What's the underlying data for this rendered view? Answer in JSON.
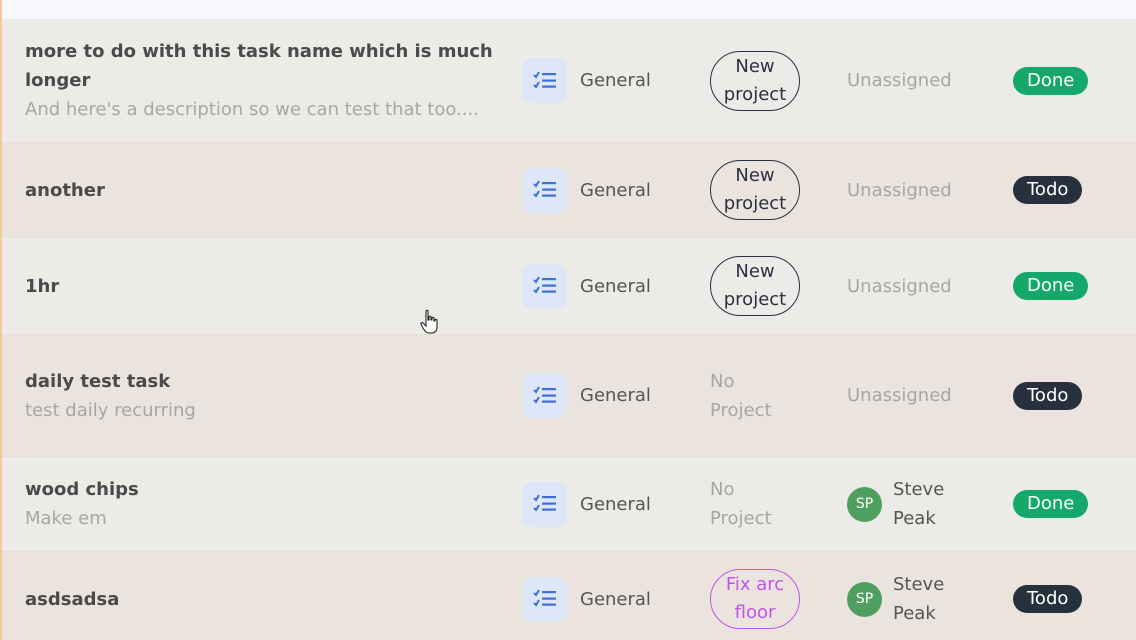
{
  "colors": {
    "done": "#14a86a",
    "todo": "#27313d",
    "project_default": "#2a3040",
    "project_purple": "#c054e6",
    "avatar": "#4ea061",
    "type_icon": "#3f6fd8"
  },
  "tasks": [
    {
      "title": "more to do with this task name which is much longer",
      "description": "And here's a description so we can test that too....",
      "type_icon": "checklist-icon",
      "type": "General",
      "project": "New project",
      "project_style": "pill",
      "assignee": "Unassigned",
      "assignee_initials": "",
      "status": "Done"
    },
    {
      "title": "another",
      "description": "",
      "type_icon": "checklist-icon",
      "type": "General",
      "project": "New project",
      "project_style": "pill",
      "assignee": "Unassigned",
      "assignee_initials": "",
      "status": "Todo"
    },
    {
      "title": "1hr",
      "description": "",
      "type_icon": "checklist-icon",
      "type": "General",
      "project": "New project",
      "project_style": "pill",
      "assignee": "Unassigned",
      "assignee_initials": "",
      "status": "Done"
    },
    {
      "title": "daily test task",
      "description": "test daily recurring",
      "type_icon": "checklist-icon",
      "type": "General",
      "project": "No Project",
      "project_style": "none",
      "assignee": "Unassigned",
      "assignee_initials": "",
      "status": "Todo"
    },
    {
      "title": "wood chips",
      "description": "Make em",
      "type_icon": "checklist-icon",
      "type": "General",
      "project": "No Project",
      "project_style": "none",
      "assignee": "Steve Peak",
      "assignee_initials": "SP",
      "status": "Done"
    },
    {
      "title": "asdsadsa",
      "description": "",
      "type_icon": "checklist-icon",
      "type": "General",
      "project": "Fix arc floor",
      "project_style": "pill-purple",
      "assignee": "Steve Peak",
      "assignee_initials": "SP",
      "status": "Todo"
    }
  ]
}
